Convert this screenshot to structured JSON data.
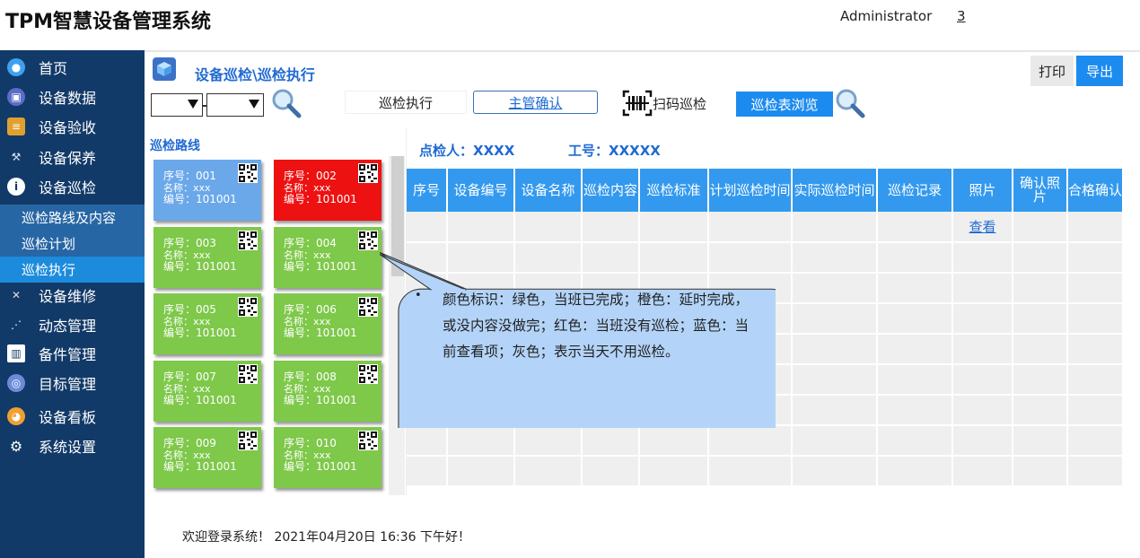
{
  "app_title": "TPM智慧设备管理系统",
  "user": {
    "name": "Administrator",
    "count": "3"
  },
  "sidebar": {
    "items": [
      {
        "label": "首页",
        "icon": "globe-icon"
      },
      {
        "label": "设备数据",
        "icon": "monitor-icon"
      },
      {
        "label": "设备验收",
        "icon": "clipboard-icon"
      },
      {
        "label": "设备保养",
        "icon": "tools-icon"
      },
      {
        "label": "设备巡检",
        "icon": "info-icon"
      },
      {
        "label": "设备维修",
        "icon": "wrench-icon"
      },
      {
        "label": "动态管理",
        "icon": "share-icon"
      },
      {
        "label": "备件管理",
        "icon": "barcode-icon"
      },
      {
        "label": "目标管理",
        "icon": "target-icon"
      },
      {
        "label": "设备看板",
        "icon": "dashboard-icon"
      },
      {
        "label": "系统设置",
        "icon": "gear-icon"
      }
    ],
    "sub_items": [
      "巡检路线及内容",
      "巡检计划",
      "巡检执行"
    ]
  },
  "page": {
    "title": "设备巡检\\巡检执行",
    "print_label": "打印",
    "export_label": "导出",
    "tab_exec": "巡检执行",
    "tab_confirm": "主管确认",
    "scan_label": "扫码巡检",
    "browse_label": "巡检表浏览"
  },
  "route": {
    "label": "巡检路线",
    "cards": [
      {
        "seq": "序号：001",
        "name": "名称：xxx",
        "code": "编号：101001",
        "color": "blue"
      },
      {
        "seq": "序号：002",
        "name": "名称：xxx",
        "code": "编号：101001",
        "color": "red"
      },
      {
        "seq": "序号：003",
        "name": "名称：xxx",
        "code": "编号：101001",
        "color": "green"
      },
      {
        "seq": "序号：004",
        "name": "名称：xxx",
        "code": "编号：101001",
        "color": "green"
      },
      {
        "seq": "序号：005",
        "name": "名称：xxx",
        "code": "编号：101001",
        "color": "green"
      },
      {
        "seq": "序号：006",
        "name": "名称：xxx",
        "code": "编号：101001",
        "color": "green"
      },
      {
        "seq": "序号：007",
        "name": "名称：xxx",
        "code": "编号：101001",
        "color": "green"
      },
      {
        "seq": "序号：008",
        "name": "名称：xxx",
        "code": "编号：101001",
        "color": "green"
      },
      {
        "seq": "序号：009",
        "name": "名称：xxx",
        "code": "编号：101001",
        "color": "green"
      },
      {
        "seq": "序号：010",
        "name": "名称：xxx",
        "code": "编号：101001",
        "color": "green"
      }
    ]
  },
  "inspector": "点检人：XXXX",
  "employee_no": "工号：XXXXX",
  "table": {
    "headers": [
      "序号",
      "设备编号",
      "设备名称",
      "巡检内容",
      "巡检标准",
      "计划巡检时间",
      "实际巡检时间",
      "巡检记录",
      "照片",
      "确认照片",
      "合格确认"
    ],
    "view_link": "查看"
  },
  "callout_text": "颜色标识：绿色，当班已完成；橙色：延时完成，或没内容没做完；红色：当班没有巡检；蓝色：当前查看项；灰色；表示当天不用巡检。",
  "footer": "欢迎登录系统！ 2021年04月20日 16:36 下午好！",
  "colors": {
    "sidebar": "#123a68",
    "accent": "#1c8bf0",
    "green": "#7ec84a",
    "red": "#ee1111",
    "blue": "#6aa8ea",
    "callout": "#b3d4f8"
  }
}
